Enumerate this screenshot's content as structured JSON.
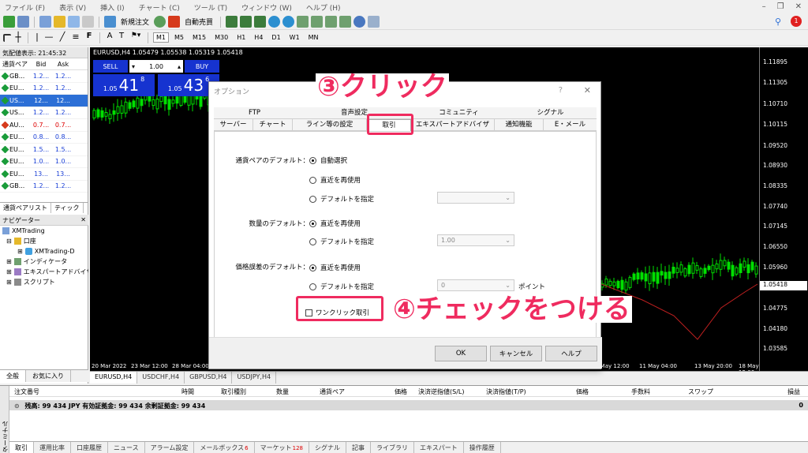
{
  "menubar": {
    "items": [
      "ファイル (F)",
      "表示 (V)",
      "挿入 (I)",
      "チャート (C)",
      "ツール (T)",
      "ウィンドウ (W)",
      "ヘルプ (H)"
    ]
  },
  "toolbar": {
    "new_order": "新規注文",
    "auto_trade": "自動売買",
    "timeframes": [
      "M1",
      "M5",
      "M15",
      "M30",
      "H1",
      "H4",
      "D1",
      "W1",
      "MN"
    ],
    "notification_count": "1"
  },
  "market_watch": {
    "title": "気配値表示: 21:45:32",
    "headers": [
      "通貨ペア",
      "Bid",
      "Ask"
    ],
    "rows": [
      {
        "symbol": "GB...",
        "bid": "1.2...",
        "ask": "1.2...",
        "dir": "up",
        "color": "blue",
        "sel": false
      },
      {
        "symbol": "EU...",
        "bid": "1.2...",
        "ask": "1.2...",
        "dir": "up",
        "color": "blue",
        "sel": false
      },
      {
        "symbol": "US...",
        "bid": "12...",
        "ask": "12...",
        "dir": "up",
        "color": "",
        "sel": true
      },
      {
        "symbol": "US...",
        "bid": "1.2...",
        "ask": "1.2...",
        "dir": "up",
        "color": "blue",
        "sel": false
      },
      {
        "symbol": "AU...",
        "bid": "0.7...",
        "ask": "0.7...",
        "dir": "dn",
        "color": "red",
        "sel": false
      },
      {
        "symbol": "EU...",
        "bid": "0.8...",
        "ask": "0.8...",
        "dir": "up",
        "color": "blue",
        "sel": false
      },
      {
        "symbol": "EU...",
        "bid": "1.5...",
        "ask": "1.5...",
        "dir": "up",
        "color": "blue",
        "sel": false
      },
      {
        "symbol": "EU...",
        "bid": "1.0...",
        "ask": "1.0...",
        "dir": "up",
        "color": "blue",
        "sel": false
      },
      {
        "symbol": "EU...",
        "bid": "13...",
        "ask": "13...",
        "dir": "up",
        "color": "blue",
        "sel": false
      },
      {
        "symbol": "GB...",
        "bid": "1.2...",
        "ask": "1.2...",
        "dir": "up",
        "color": "blue",
        "sel": false
      }
    ],
    "tabs": [
      "通貨ペアリスト",
      "ティック"
    ]
  },
  "navigator": {
    "title": "ナビゲーター",
    "items": [
      "XMTrading",
      "口座",
      "XMTrading-D",
      "インディケータ",
      "エキスパートアドバイザ",
      "スクリプト"
    ],
    "tabs": [
      "全般",
      "お気に入り"
    ]
  },
  "chart": {
    "title": "EURUSD,H4 1.05479 1.05538 1.05319 1.05418",
    "sell": "SELL",
    "buy": "BUY",
    "lot": "1.00",
    "sell_price": {
      "pre": "1.05",
      "big": "41",
      "sup": "8"
    },
    "buy_price": {
      "pre": "1.05",
      "big": "43",
      "sup": "6"
    },
    "price_labels": [
      "1.11895",
      "1.11305",
      "1.10710",
      "1.10115",
      "1.09520",
      "1.08930",
      "1.08335",
      "1.07740",
      "1.07145",
      "1.06550",
      "1.05960",
      "1.04775",
      "1.04180",
      "1.03585"
    ],
    "current_price": "1.05418",
    "time_labels": [
      "20 Mar 2022",
      "23 Mar 12:00",
      "28 Mar 04:00",
      "6 May 12:00",
      "11 May 04:00",
      "13 May 20:00",
      "18 May 12:00"
    ],
    "tabs": [
      "EURUSD,H4",
      "USDCHF,H4",
      "GBPUSD,H4",
      "USDJPY,H4"
    ]
  },
  "terminal": {
    "side_label": "ターミナル",
    "headers": [
      "注文番号",
      "時間",
      "取引種別",
      "数量",
      "通貨ペア",
      "価格",
      "決済逆指値(S/L)",
      "決済指値(T/P)",
      "価格",
      "手数料",
      "スワップ",
      "損益"
    ],
    "balance": "残高: 99 434 JPY  有効証拠金: 99 434  余剰証拠金: 99 434",
    "balance_value": "0",
    "tabs": [
      {
        "label": "取引",
        "badge": ""
      },
      {
        "label": "運用比率",
        "badge": ""
      },
      {
        "label": "口座履歴",
        "badge": ""
      },
      {
        "label": "ニュース",
        "badge": ""
      },
      {
        "label": "アラーム設定",
        "badge": ""
      },
      {
        "label": "メールボックス",
        "badge": "6"
      },
      {
        "label": "マーケット",
        "badge": "128"
      },
      {
        "label": "シグナル",
        "badge": ""
      },
      {
        "label": "記事",
        "badge": ""
      },
      {
        "label": "ライブラリ",
        "badge": ""
      },
      {
        "label": "エキスパート",
        "badge": ""
      },
      {
        "label": "操作履歴",
        "badge": ""
      }
    ]
  },
  "dialog": {
    "title": "オプション",
    "help": "?",
    "close": "✕",
    "tabs_top": [
      "FTP",
      "音声設定",
      "コミュニティ",
      "シグナル"
    ],
    "tabs_bottom": [
      "サーバー",
      "チャート",
      "ライン等の設定",
      "取引",
      "エキスパートアドバイザ",
      "通知機能",
      "E・メール"
    ],
    "symbol_default": {
      "label": "通貨ペアのデフォルト：",
      "opts": [
        "自動選択",
        "直近を再使用",
        "デフォルトを指定"
      ],
      "combo": ""
    },
    "volume_default": {
      "label": "数量のデフォルト：",
      "opts": [
        "直近を再使用",
        "デフォルトを指定"
      ],
      "combo": "1.00"
    },
    "deviation_default": {
      "label": "価格誤差のデフォルト：",
      "opts": [
        "直近を再使用",
        "デフォルトを指定"
      ],
      "combo": "0",
      "unit": "ポイント"
    },
    "one_click": "ワンクリック取引",
    "ok": "OK",
    "cancel": "キャンセル",
    "help_btn": "ヘルプ"
  },
  "annotations": {
    "click": "③クリック",
    "check": "④チェックをつける",
    "color": "#ef2b5f"
  }
}
